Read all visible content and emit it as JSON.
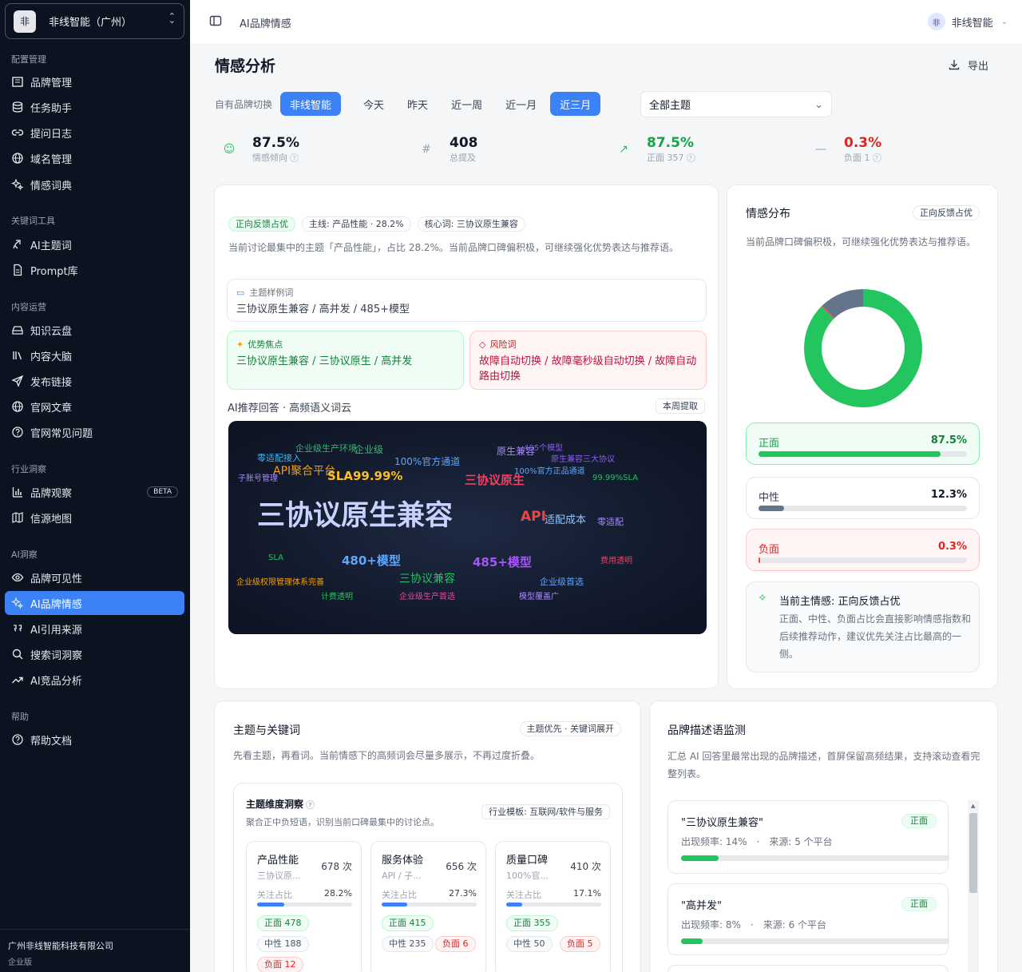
{
  "org": {
    "logo": "非",
    "name": "非线智能（广州）"
  },
  "sidebar": {
    "sections": [
      "配置管理",
      "关键词工具",
      "内容运营",
      "行业洞察",
      "AI洞察",
      "帮助"
    ],
    "items": [
      {
        "label": "品牌管理",
        "icon": "building-icon"
      },
      {
        "label": "任务助手",
        "icon": "database-icon"
      },
      {
        "label": "提问日志",
        "icon": "link-icon"
      },
      {
        "label": "域名管理",
        "icon": "globe-icon"
      },
      {
        "label": "情感词典",
        "icon": "sparkle-icon"
      },
      {
        "label": "AI主题词",
        "icon": "theme-icon"
      },
      {
        "label": "Prompt库",
        "icon": "file-icon"
      },
      {
        "label": "知识云盘",
        "icon": "drive-icon"
      },
      {
        "label": "内容大脑",
        "icon": "library-icon"
      },
      {
        "label": "发布链接",
        "icon": "send-icon"
      },
      {
        "label": "官网文章",
        "icon": "globe-icon"
      },
      {
        "label": "官网常见问题",
        "icon": "help-circle-icon"
      },
      {
        "label": "品牌观察",
        "icon": "bar-chart-icon",
        "badge": "BETA"
      },
      {
        "label": "信源地图",
        "icon": "map-icon"
      },
      {
        "label": "品牌可见性",
        "icon": "eye-icon"
      },
      {
        "label": "AI品牌情感",
        "icon": "sparkle-icon"
      },
      {
        "label": "AI引用来源",
        "icon": "quote-icon"
      },
      {
        "label": "搜索词洞察",
        "icon": "search-icon"
      },
      {
        "label": "AI竞品分析",
        "icon": "trend-icon"
      },
      {
        "label": "帮助文档",
        "icon": "help-circle-icon"
      }
    ],
    "footer": {
      "company": "广州非线智能科技有限公司",
      "edition": "企业版"
    }
  },
  "topbar": {
    "breadcrumb": "AI品牌情感",
    "user_avatar": "非",
    "user_name": "非线智能"
  },
  "page": {
    "title": "情感分析",
    "export_label": "导出"
  },
  "filters": {
    "brand_label": "自有品牌切换",
    "brand": "非线智能",
    "ranges": [
      "今天",
      "昨天",
      "近一周",
      "近一月",
      "近三月"
    ],
    "topic_select": "全部主题"
  },
  "kpis": [
    {
      "value": "87.5%",
      "label": "情感倾向",
      "color": "#111827"
    },
    {
      "value": "408",
      "label": "总提及",
      "color": "#111827"
    },
    {
      "value": "87.5%",
      "label": "正面 357",
      "color": "#16a34a"
    },
    {
      "value": "0.3%",
      "label": "负面 1",
      "color": "#dc2626"
    }
  ],
  "summary": {
    "chips": [
      "正向反馈占优",
      "主线: 产品性能 · 28.2%",
      "核心词: 三协议原生兼容"
    ],
    "text": "当前讨论最集中的主题「产品性能」，占比 28.2%。当前品牌口碑偏积极，可继续强化优势表达与推荐语。",
    "sample_title": "主题样例词",
    "sample_value": "三协议原生兼容 / 高并发 / 485+模型",
    "adv_title": "优势焦点",
    "adv_value": "三协议原生兼容 / 三协议原生 / 高并发",
    "risk_title": "风险词",
    "risk_value": "故障自动切换 / 故障毫秒级自动切换 / 故障自动路由切换",
    "cloud_title": "AI推荐回答 · 高频语义词云",
    "cloud_badge": "本周提取",
    "words": [
      {
        "t": "企业级生产环境",
        "c": "#3bb273"
      },
      {
        "t": "企业级",
        "c": "#3bb273"
      },
      {
        "t": "零适配接入",
        "c": "#38bdf8"
      },
      {
        "t": "100%官方通道",
        "c": "#60a5fa"
      },
      {
        "t": "原生兼容",
        "c": "#a78bfa"
      },
      {
        "t": "485个模型",
        "c": "#8b5cf6"
      },
      {
        "t": "原生兼容三大协议",
        "c": "#8b5cf6"
      },
      {
        "t": "API聚合平台",
        "c": "#f59e0b"
      },
      {
        "t": "子账号管理",
        "c": "#a78bfa"
      },
      {
        "t": "SLA99.99%",
        "c": "#fbbf24"
      },
      {
        "t": "100%官方正品通道",
        "c": "#60a5fa"
      },
      {
        "t": "三协议原生",
        "c": "#f43f5e"
      },
      {
        "t": "99.99%SLA",
        "c": "#22c55e"
      },
      {
        "t": "三协议原生兼容",
        "c": "#c7d2fe"
      },
      {
        "t": "API",
        "c": "#ef4444"
      },
      {
        "t": "适配成本",
        "c": "#93c5fd"
      },
      {
        "t": "零适配",
        "c": "#a78bfa"
      },
      {
        "t": "SLA",
        "c": "#22c55e"
      },
      {
        "t": "480+模型",
        "c": "#60a5fa"
      },
      {
        "t": "485+模型",
        "c": "#a855f7"
      },
      {
        "t": "费用透明",
        "c": "#f43f5e"
      },
      {
        "t": "企业级权限管理体系完善",
        "c": "#f59e0b"
      },
      {
        "t": "三协议兼容",
        "c": "#22c55e"
      },
      {
        "t": "企业级首选",
        "c": "#60a5fa"
      },
      {
        "t": "计费透明",
        "c": "#22c55e"
      },
      {
        "t": "企业级生产首选",
        "c": "#ec4899"
      },
      {
        "t": "模型覆盖广",
        "c": "#a78bfa"
      }
    ]
  },
  "distribution": {
    "title": "情感分布",
    "badge": "正向反馈占优",
    "text": "当前品牌口碑偏积极，可继续强化优势表达与推荐语。",
    "items": [
      {
        "label": "正面",
        "value": "87.5%",
        "pct": 87.5,
        "color": "#22c55e"
      },
      {
        "label": "中性",
        "value": "12.3%",
        "pct": 12.3,
        "color": "#64748b"
      },
      {
        "label": "负面",
        "value": "0.3%",
        "pct": 0.3,
        "color": "#ef4444"
      }
    ],
    "main_title": "当前主情感: 正向反馈占优",
    "main_text": "正面、中性、负面占比会直接影响情感指数和后续推荐动作，建议优先关注占比最高的一侧。"
  },
  "topics": {
    "title": "主题与关键词",
    "badge": "主题优先 · 关键词展开",
    "text": "先看主题，再看词。当前情感下的高频词会尽量多展示，不再过度折叠。",
    "panel_title": "主题维度洞察",
    "panel_sub": "聚合正中负短语，识别当前口碑最集中的讨论点。",
    "template": "行业模板: 互联网/软件与服务",
    "ratio_label": "关注占比",
    "dims": [
      {
        "name": "产品性能",
        "sub": "三协议原...",
        "count": "678 次",
        "ratio": "28.2%",
        "pct": 28.2,
        "pos": "正面 478",
        "neu": "中性 188",
        "neg": "负面 12"
      },
      {
        "name": "服务体验",
        "sub": "API / 子...",
        "count": "656 次",
        "ratio": "27.3%",
        "pct": 27.3,
        "pos": "正面 415",
        "neu": "中性 235",
        "neg": "负面 6"
      },
      {
        "name": "质量口碑",
        "sub": "100%官...",
        "count": "410 次",
        "ratio": "17.1%",
        "pct": 17.1,
        "pos": "正面 355",
        "neu": "中性 50",
        "neg": "负面 5"
      }
    ]
  },
  "monitor": {
    "title": "品牌描述语监测",
    "text": "汇总 AI 回答里最常出现的品牌描述，首屏保留高频结果，支持滚动查看完整列表。",
    "items": [
      {
        "phrase": "\"三协议原生兼容\"",
        "freq": "出现频率: 14%",
        "source": "来源: 5 个平台",
        "sentiment": "正面",
        "pct": 14
      },
      {
        "phrase": "\"高并发\"",
        "freq": "出现频率: 8%",
        "source": "来源: 6 个平台",
        "sentiment": "正面",
        "pct": 8
      }
    ]
  }
}
